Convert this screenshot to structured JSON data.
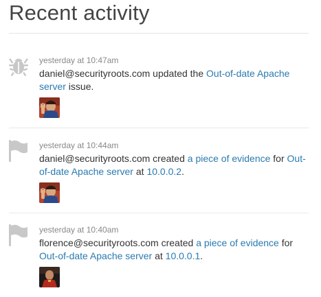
{
  "page": {
    "title": "Recent activity"
  },
  "colors": {
    "link": "#2a7ab0",
    "icon": "#c8c8c8",
    "timestamp": "#888888"
  },
  "activities": [
    {
      "icon": "bug-icon",
      "time": "yesterday at 10:47am",
      "actor": "daniel@securityroots.com",
      "verb": " updated the ",
      "link1": "Out-of-date Apache server",
      "tail": " issue."
    },
    {
      "icon": "flag-icon",
      "time": "yesterday at 10:44am",
      "actor": "daniel@securityroots.com",
      "verb": " created ",
      "link1": "a piece of evidence",
      "mid1": " for ",
      "link2": "Out-of-date Apache server",
      "mid2": " at ",
      "link3": "10.0.0.2",
      "tail": "."
    },
    {
      "icon": "flag-icon",
      "time": "yesterday at 10:40am",
      "actor": "florence@securityroots.com",
      "verb": " created ",
      "link1": "a piece of evidence",
      "mid1": " for ",
      "link2": "Out-of-date Apache server",
      "mid2": " at ",
      "link3": "10.0.0.1",
      "tail": "."
    }
  ]
}
